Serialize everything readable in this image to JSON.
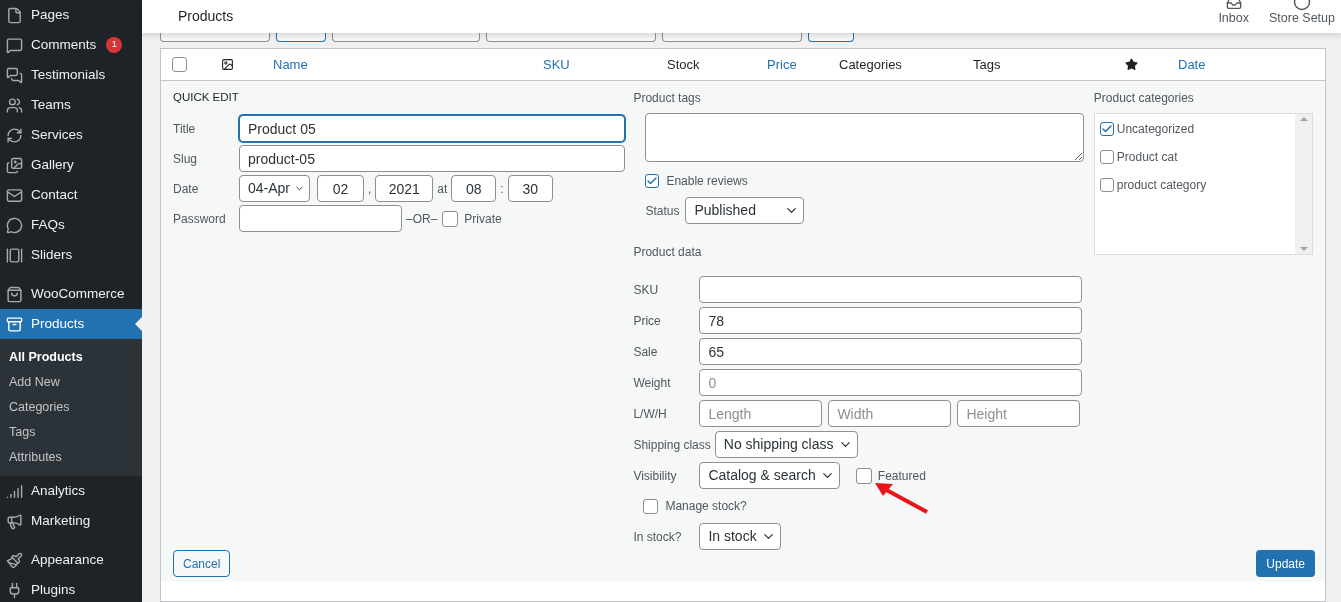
{
  "sidebar": {
    "sections": [
      {
        "items": [
          {
            "label": "Pages",
            "selected": false
          },
          {
            "label": "Comments",
            "badge": "1",
            "selected": false
          },
          {
            "label": "Testimonials",
            "selected": false
          },
          {
            "label": "Teams",
            "selected": false
          },
          {
            "label": "Services",
            "selected": false
          },
          {
            "label": "Gallery",
            "selected": false
          },
          {
            "label": "Contact",
            "selected": false
          },
          {
            "label": "FAQs",
            "selected": false
          },
          {
            "label": "Sliders",
            "selected": false
          }
        ]
      },
      {
        "items": [
          {
            "label": "WooCommerce",
            "selected": false
          },
          {
            "label": "Products",
            "selected": true,
            "children": [
              {
                "label": "All Products",
                "selected": true
              },
              {
                "label": "Add New",
                "selected": false
              },
              {
                "label": "Categories",
                "selected": false
              },
              {
                "label": "Tags",
                "selected": false
              },
              {
                "label": "Attributes",
                "selected": false
              }
            ]
          },
          {
            "label": "Analytics",
            "selected": false
          },
          {
            "label": "Marketing",
            "selected": false
          }
        ]
      },
      {
        "items": [
          {
            "label": "Appearance",
            "selected": false
          },
          {
            "label": "Plugins",
            "selected": false
          }
        ]
      }
    ]
  },
  "header": {
    "title": "Products",
    "actions": [
      {
        "label": "Inbox"
      },
      {
        "label": "Store Setup"
      }
    ]
  },
  "table": {
    "select_all": {
      "checked": false
    },
    "columns": [
      {
        "label": "Name",
        "sortable": true
      },
      {
        "label": "SKU",
        "sortable": true
      },
      {
        "label": "Stock",
        "sortable": false
      },
      {
        "label": "Price",
        "sortable": true
      },
      {
        "label": "Categories",
        "sortable": false
      },
      {
        "label": "Tags",
        "sortable": false
      },
      {
        "label": "Date",
        "sortable": true
      }
    ]
  },
  "quick_edit": {
    "heading": "QUICK EDIT",
    "title": {
      "label": "Title",
      "value": "Product 05"
    },
    "slug": {
      "label": "Slug",
      "value": "product-05"
    },
    "date": {
      "label": "Date",
      "month": "04-Apr",
      "day": "02",
      "separator_1": ",",
      "year": "2021",
      "at": "at",
      "hour": "08",
      "separator_2": ":",
      "minute": "30"
    },
    "password": {
      "label": "Password",
      "or": "–OR–",
      "private": {
        "label": "Private",
        "checked": false
      }
    },
    "product_tags": {
      "label": "Product tags"
    },
    "enable_reviews": {
      "label": "Enable reviews",
      "checked": true
    },
    "status": {
      "label": "Status",
      "value": "Published"
    },
    "product_data": {
      "heading": "Product data",
      "rows": [
        {
          "kind": "input",
          "label": "SKU"
        },
        {
          "kind": "input",
          "label": "Price",
          "value": "78"
        },
        {
          "kind": "input",
          "label": "Sale",
          "value": "65"
        },
        {
          "kind": "input",
          "label": "Weight",
          "placeholder": "0"
        },
        {
          "kind": "dimensions",
          "label": "L/W/H",
          "placeholders": [
            "Length",
            "Width",
            "Height"
          ]
        },
        {
          "kind": "select",
          "label": "Shipping class",
          "value": "No shipping class"
        },
        {
          "kind": "select",
          "label": "Visibility",
          "value": "Catalog & search",
          "checkbox": {
            "label": "Featured",
            "checked": false
          }
        },
        {
          "kind": "checkbox",
          "label": "Manage stock?",
          "checked": false
        },
        {
          "kind": "select",
          "label": "In stock?",
          "value": "In stock"
        }
      ]
    },
    "categories": {
      "label": "Product categories",
      "items": [
        {
          "label": "Uncategorized",
          "checked": true
        },
        {
          "label": "Product cat",
          "checked": false
        },
        {
          "label": "product category",
          "checked": false
        }
      ]
    },
    "cancel": "Cancel",
    "update": "Update"
  }
}
